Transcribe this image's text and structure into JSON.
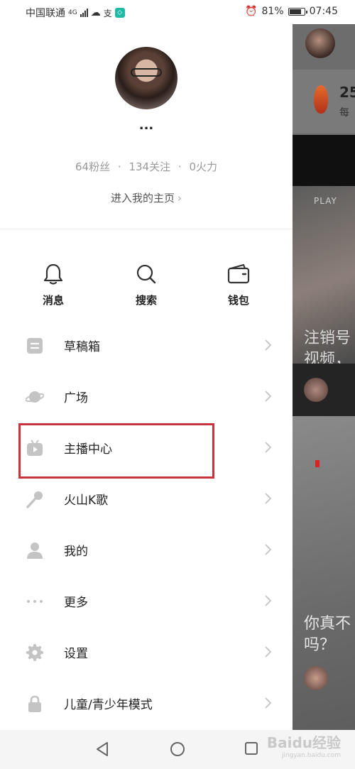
{
  "status_bar": {
    "carrier": "中国联通",
    "network": "4G",
    "battery": "81%",
    "time": "07:45"
  },
  "profile": {
    "name": "...",
    "stats": [
      "64粉丝",
      "134关注",
      "0火力"
    ],
    "separator": "·",
    "homepage_link": "进入我的主页"
  },
  "quick_actions": [
    {
      "label": "消息",
      "icon": "bell-icon"
    },
    {
      "label": "搜索",
      "icon": "search-icon"
    },
    {
      "label": "钱包",
      "icon": "wallet-icon"
    }
  ],
  "menu": [
    {
      "label": "草稿箱",
      "icon": "draft-box-icon"
    },
    {
      "label": "广场",
      "icon": "planet-icon"
    },
    {
      "label": "主播中心",
      "icon": "tv-icon"
    },
    {
      "label": "火山K歌",
      "icon": "microphone-icon"
    },
    {
      "label": "我的",
      "icon": "person-icon"
    },
    {
      "label": "更多",
      "icon": "more-dots-icon"
    },
    {
      "label": "设置",
      "icon": "gear-icon"
    },
    {
      "label": "儿童/青少年模式",
      "icon": "lock-icon"
    }
  ],
  "background_app": {
    "count": "25",
    "count_sub": "每",
    "play_label": "PLAY",
    "caption1": "注销号视频，",
    "caption2": "你真不吗？"
  },
  "watermark": {
    "brand": "Baidu经验",
    "url": "jingyan.baidu.com"
  },
  "colors": {
    "highlight": "#c8343a",
    "icon_gray": "#c4c4c4",
    "text_gray": "#999999"
  }
}
